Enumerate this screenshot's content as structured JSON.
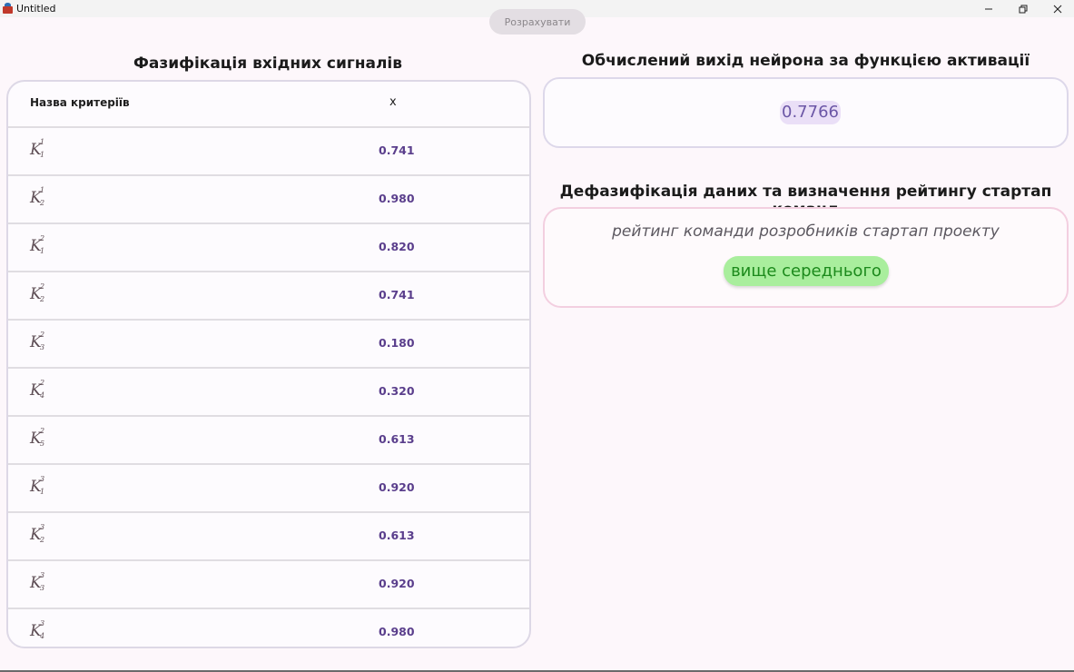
{
  "window": {
    "title": "Untitled"
  },
  "toolbar": {
    "calculate_label": "Розрахувати"
  },
  "left": {
    "title": "Фазифікація вхідних сигналів",
    "columns": {
      "name": "Назва критеріїв",
      "x": "x"
    },
    "rows": [
      {
        "k": "K",
        "sup": "1",
        "sub": "1",
        "value": "0.741"
      },
      {
        "k": "K",
        "sup": "1",
        "sub": "2",
        "value": "0.980"
      },
      {
        "k": "K",
        "sup": "2",
        "sub": "1",
        "value": "0.820"
      },
      {
        "k": "K",
        "sup": "2",
        "sub": "2",
        "value": "0.741"
      },
      {
        "k": "K",
        "sup": "2",
        "sub": "3",
        "value": "0.180"
      },
      {
        "k": "K",
        "sup": "2",
        "sub": "4",
        "value": "0.320"
      },
      {
        "k": "K",
        "sup": "2",
        "sub": "5",
        "value": "0.613"
      },
      {
        "k": "K",
        "sup": "3",
        "sub": "1",
        "value": "0.920"
      },
      {
        "k": "K",
        "sup": "3",
        "sub": "2",
        "value": "0.613"
      },
      {
        "k": "K",
        "sup": "3",
        "sub": "3",
        "value": "0.920"
      },
      {
        "k": "K",
        "sup": "3",
        "sub": "4",
        "value": "0.980"
      }
    ]
  },
  "output": {
    "title": "Обчислений вихід нейрона за функцією активації",
    "value": "0.7766"
  },
  "rating": {
    "title": "Дефазифікація даних та визначення рейтингу стартап команд",
    "caption": "рейтинг команди розробників стартап проекту",
    "result": "вище середнього",
    "result_color": "#1c8a1c",
    "result_bg": "#a9ee9d"
  }
}
